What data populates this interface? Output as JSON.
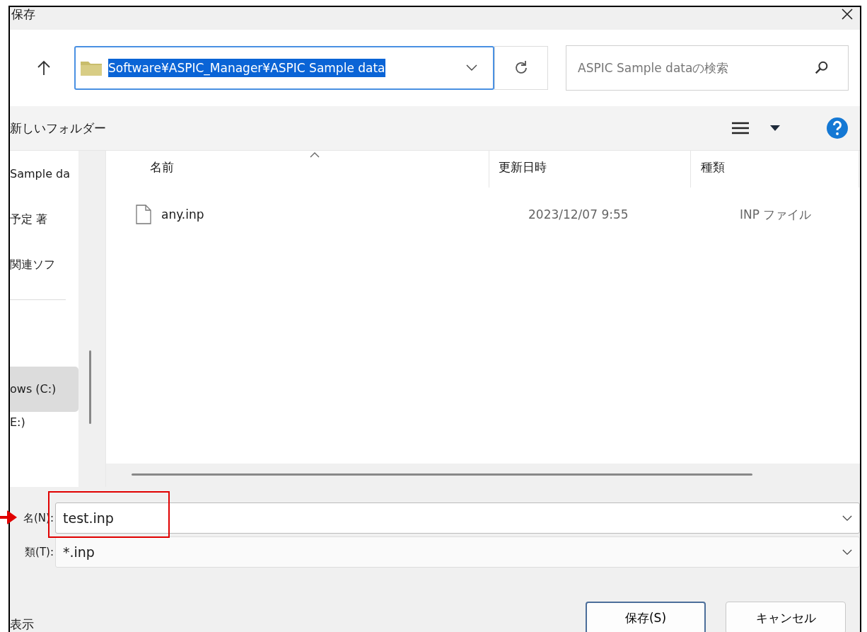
{
  "window": {
    "title": "保存"
  },
  "address_bar": {
    "path": "Software¥ASPIC_Manager¥ASPIC Sample data",
    "selected": true
  },
  "search": {
    "placeholder": "ASPIC Sample dataの検索"
  },
  "toolbar": {
    "new_folder": "新しいフォルダー"
  },
  "sidebar": {
    "items": [
      {
        "kind": "item",
        "label": "Sample da",
        "selected": false
      },
      {
        "kind": "item",
        "label": "予定 著",
        "selected": false
      },
      {
        "kind": "item",
        "label": "関連ソフ",
        "selected": false
      },
      {
        "kind": "separator"
      },
      {
        "kind": "spacer"
      },
      {
        "kind": "item",
        "label": "ows (C:)",
        "selected": true
      },
      {
        "kind": "item",
        "label": "E:)",
        "selected": false
      }
    ]
  },
  "file_list": {
    "columns": [
      {
        "label": "名前",
        "sorted": true
      },
      {
        "label": "更新日時",
        "sorted": false
      },
      {
        "label": "種類",
        "sorted": false
      }
    ],
    "rows": [
      {
        "name": "any.inp",
        "modified": "2023/12/07 9:55",
        "type": "INP ファイル",
        "selected": false
      }
    ]
  },
  "filename": {
    "label": "名(N):",
    "value": "test.inp"
  },
  "filetype": {
    "label": "類(T):",
    "value": "*.inp"
  },
  "hide_folders": "表示",
  "buttons": [
    {
      "label": "保存(S)",
      "default": true
    },
    {
      "label": "キャンセル",
      "default": false
    }
  ]
}
